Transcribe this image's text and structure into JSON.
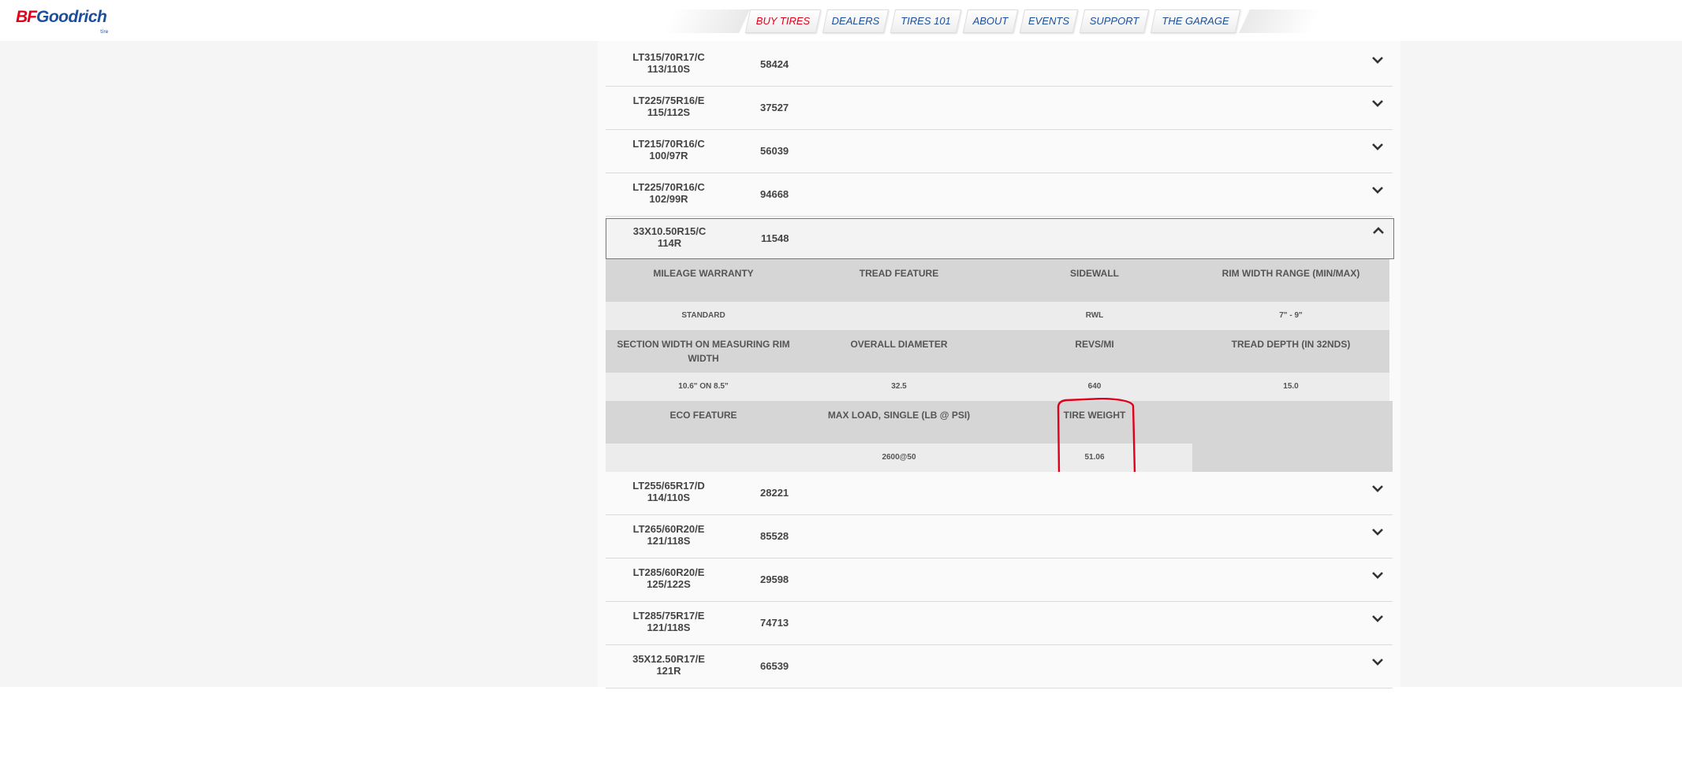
{
  "brand": {
    "name_part1": "BF",
    "name_part2": "Goodrich",
    "tm": "tire"
  },
  "nav": {
    "items": [
      {
        "label": "BUY TIRES",
        "active": true
      },
      {
        "label": "DEALERS",
        "active": false
      },
      {
        "label": "TIRES 101",
        "active": false
      },
      {
        "label": "ABOUT",
        "active": false
      },
      {
        "label": "EVENTS",
        "active": false
      },
      {
        "label": "SUPPORT",
        "active": false
      },
      {
        "label": "THE GARAGE",
        "active": false
      }
    ]
  },
  "tires_before": [
    {
      "size": "LT315/70R17/C",
      "load": "113/110S",
      "article": "58424"
    },
    {
      "size": "LT225/75R16/E",
      "load": "115/112S",
      "article": "37527"
    },
    {
      "size": "LT215/70R16/C",
      "load": "100/97R",
      "article": "56039"
    },
    {
      "size": "LT225/70R16/C",
      "load": "102/99R",
      "article": "94668"
    }
  ],
  "expanded": {
    "size": "33X10.50R15/C",
    "load": "114R",
    "article": "11548",
    "headers1": [
      "MILEAGE WARRANTY",
      "TREAD FEATURE",
      "SIDEWALL",
      "RIM WIDTH RANGE (MIN/MAX)"
    ],
    "values1": [
      "STANDARD",
      "",
      "RWL",
      "7\" - 9\""
    ],
    "headers2": [
      "SECTION WIDTH ON MEASURING RIM WIDTH",
      "OVERALL DIAMETER",
      "REVS/MI",
      "TREAD DEPTH (IN 32NDS)"
    ],
    "values2": [
      "10.6\" ON 8.5\"",
      "32.5",
      "640",
      "15.0"
    ],
    "headers3": [
      "ECO FEATURE",
      "MAX LOAD, SINGLE (LB @ PSI)",
      "TIRE WEIGHT"
    ],
    "values3": [
      "",
      "2600@50",
      "51.06"
    ]
  },
  "tires_after": [
    {
      "size": "LT255/65R17/D",
      "load": "114/110S",
      "article": "28221"
    },
    {
      "size": "LT265/60R20/E",
      "load": "121/118S",
      "article": "85528"
    },
    {
      "size": "LT285/60R20/E",
      "load": "125/122S",
      "article": "29598"
    },
    {
      "size": "LT285/75R17/E",
      "load": "121/118S",
      "article": "74713"
    },
    {
      "size": "35X12.50R17/E",
      "load": "121R",
      "article": "66539"
    }
  ],
  "colors": {
    "brand_red": "#e2001a",
    "brand_blue": "#1a4f9c",
    "annotation_red": "#e0001b"
  },
  "icons": {
    "collapsed": "chevron-down-icon",
    "expanded": "chevron-up-icon"
  }
}
